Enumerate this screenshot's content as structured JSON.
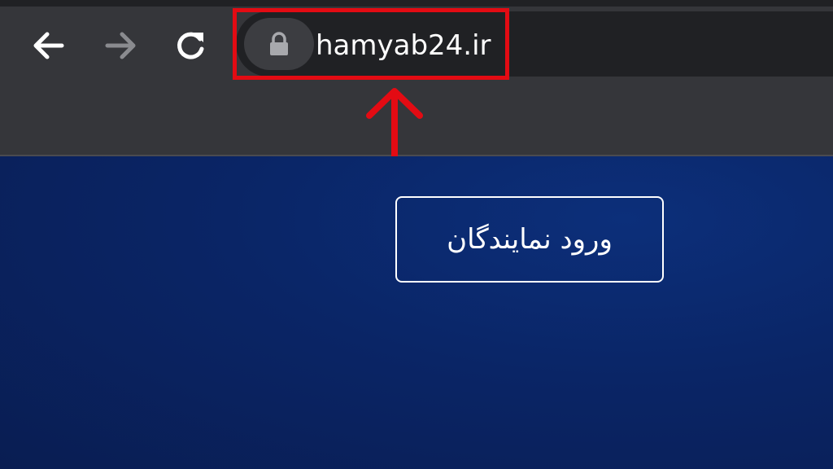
{
  "browser": {
    "url": "hamyab24.ir",
    "icons": {
      "back": "arrow-left-icon",
      "forward": "arrow-right-icon",
      "reload": "reload-icon",
      "lock": "lock-icon"
    }
  },
  "page": {
    "login_button_label": "ورود نمایندگان"
  },
  "annotation": {
    "highlight_color": "#e30b13"
  },
  "colors": {
    "chrome_bg": "#35363a",
    "omnibox_bg": "#202124",
    "content_bg": "#0b2360",
    "text": "#ffffff"
  }
}
